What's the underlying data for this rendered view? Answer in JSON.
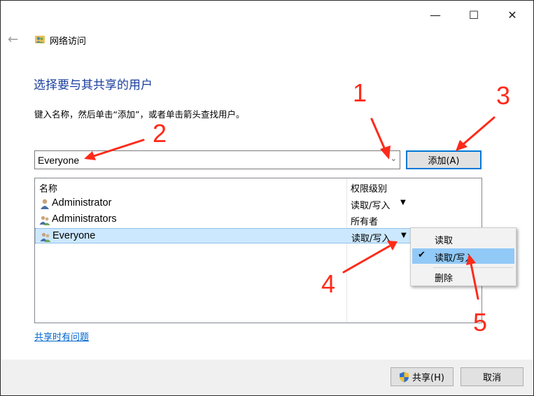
{
  "window": {
    "minimize_glyph": "—",
    "maximize_glyph": "☐",
    "close_glyph": "✕",
    "back_glyph": "←",
    "title": "网络访问"
  },
  "main": {
    "heading": "选择要与其共享的用户",
    "instruction": "键入名称，然后单击“添加”，或者单击箭头查找用户。",
    "input_value": "Everyone",
    "add_button": "添加(A)",
    "columns": {
      "name": "名称",
      "permission": "权限级别"
    },
    "rows": [
      {
        "name": "Administrator",
        "permission": "读取/写入",
        "icon": "user-icon"
      },
      {
        "name": "Administrators",
        "permission": "所有者",
        "icon": "group-icon"
      },
      {
        "name": "Everyone",
        "permission": "读取/写入",
        "icon": "group-icon"
      }
    ],
    "permission_menu": [
      {
        "label": "读取",
        "checked": false
      },
      {
        "label": "读取/写入",
        "checked": true
      },
      {
        "label": "删除",
        "checked": false
      }
    ],
    "help_link": "共享时有问题"
  },
  "footer": {
    "share_button": "共享(H)",
    "cancel_button": "取消"
  },
  "annotations": [
    "1",
    "2",
    "3",
    "4",
    "5"
  ],
  "colors": {
    "annotation": "#ff2a1a",
    "heading": "#1a3e9e",
    "selection": "#cce8ff",
    "menu_highlight": "#91c9f7",
    "link": "#0066cc"
  }
}
